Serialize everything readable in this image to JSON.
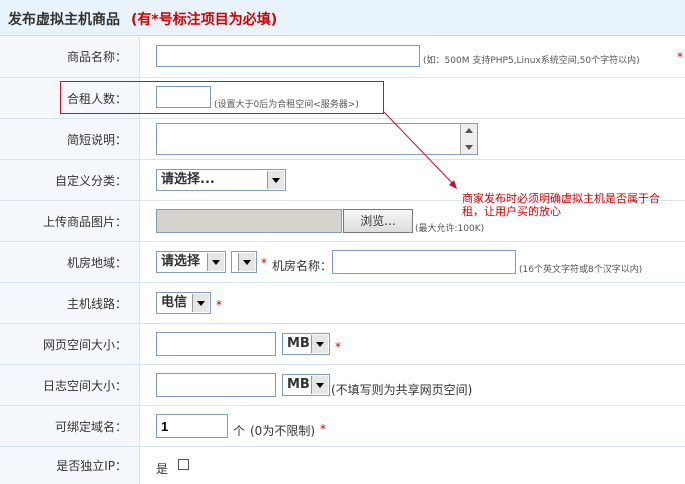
{
  "header": {
    "title": "发布虚拟主机商品",
    "note": "(有*号标注项目为必填)"
  },
  "required_mark": "*",
  "product_name": {
    "label": "商品名称：",
    "value": "",
    "hint": "(如：500M 支持PHP5,Linux系统空间,50个字符以内)"
  },
  "renters": {
    "label": "合租人数：",
    "value": "",
    "hint": "(设置大于0后为合租空间<服务器>)"
  },
  "short_desc": {
    "label": "简短说明：",
    "value": ""
  },
  "category": {
    "label": "自定义分类：",
    "selected": "请选择..."
  },
  "annotation": {
    "text": "商家发布时必须明确虚拟主机是否属于合租，让用户买的放心",
    "color": "#d00000"
  },
  "upload": {
    "label": "上传商品图片：",
    "value": "",
    "browse_label": "浏览...",
    "hint": "(最大允许:100K)"
  },
  "datacenter": {
    "label": "机房地域：",
    "selected": "请选择",
    "selected2": "",
    "name_label": "机房名称：",
    "name_value": "",
    "hint": "(16个英文字符或8个汉字以内)"
  },
  "line": {
    "label": "主机线路：",
    "selected": "电信"
  },
  "web_space": {
    "label": "网页空间大小：",
    "value": "",
    "unit": "MB"
  },
  "log_space": {
    "label": "日志空间大小：",
    "value": "",
    "unit": "MB",
    "hint": "(不填写则为共享网页空间)"
  },
  "domains": {
    "label": "可绑定域名：",
    "value": "1",
    "unit": "个",
    "hint": "(0为不限制)"
  },
  "standalone_ip": {
    "label": "是否独立IP：",
    "option": "是",
    "checked": false
  }
}
